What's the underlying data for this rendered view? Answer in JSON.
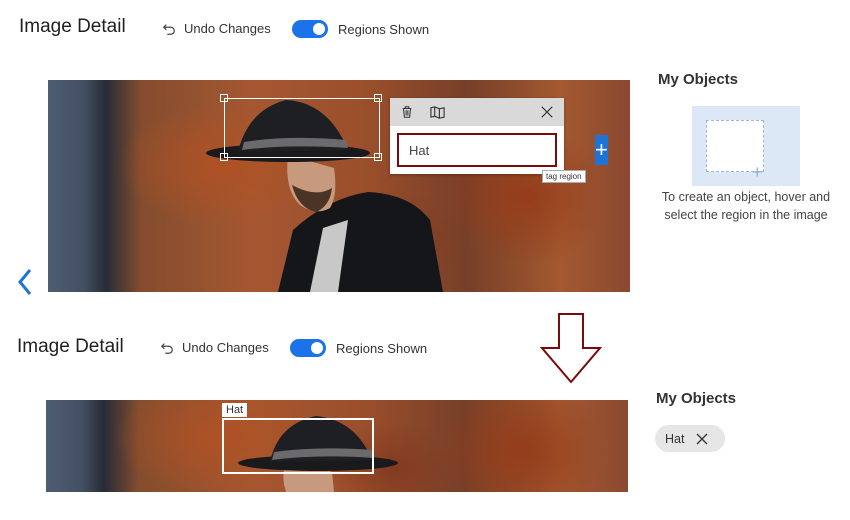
{
  "top": {
    "header": {
      "title": "Image Detail",
      "undo_label": "Undo Changes",
      "regions_label": "Regions Shown",
      "regions_on": true
    },
    "popup": {
      "input_value": "Hat",
      "add_symbol": "+",
      "tooltip": "tag region",
      "icons": [
        "trash-icon",
        "map-icon",
        "close-icon"
      ]
    },
    "objects_panel": {
      "heading": "My Objects",
      "hint": "To create an object, hover and select the region in the image"
    },
    "nav_prev_icon": "chevron-left-icon"
  },
  "bottom": {
    "header": {
      "title": "Image Detail",
      "undo_label": "Undo Changes",
      "regions_label": "Regions Shown",
      "regions_on": true
    },
    "region_label": "Hat",
    "objects_panel": {
      "heading": "My Objects",
      "chip_label": "Hat"
    }
  },
  "colors": {
    "accent": "#1e73d6",
    "highlight_border": "#7a0b0b",
    "arrow": "#7a0b0b"
  }
}
